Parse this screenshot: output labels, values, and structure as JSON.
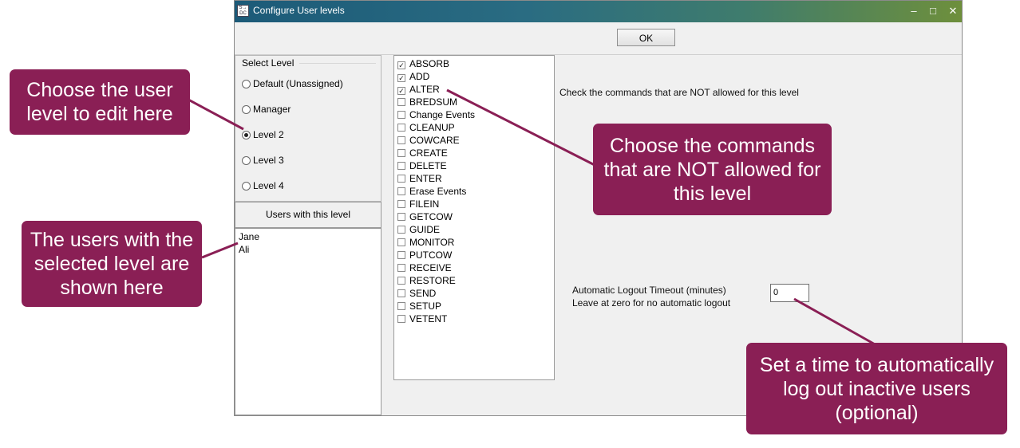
{
  "window": {
    "title": "Configure User levels",
    "icon_label": "S→\nDC",
    "controls": {
      "minimize": "–",
      "maximize": "□",
      "close": "✕"
    }
  },
  "toolbar": {
    "ok_label": "OK"
  },
  "select_level": {
    "label": "Select Level",
    "options": [
      {
        "label": "Default (Unassigned)",
        "selected": false
      },
      {
        "label": "Manager",
        "selected": false
      },
      {
        "label": "Level 2",
        "selected": true
      },
      {
        "label": "Level 3",
        "selected": false
      },
      {
        "label": "Level 4",
        "selected": false
      }
    ]
  },
  "users": {
    "header": "Users with this level",
    "list": [
      "Jane",
      "Ali"
    ]
  },
  "commands": [
    {
      "label": "ABSORB",
      "checked": true
    },
    {
      "label": "ADD",
      "checked": true
    },
    {
      "label": "ALTER",
      "checked": true
    },
    {
      "label": "BREDSUM",
      "checked": false
    },
    {
      "label": "Change Events",
      "checked": false
    },
    {
      "label": "CLEANUP",
      "checked": false
    },
    {
      "label": "COWCARE",
      "checked": false
    },
    {
      "label": "CREATE",
      "checked": false
    },
    {
      "label": "DELETE",
      "checked": false
    },
    {
      "label": "ENTER",
      "checked": false
    },
    {
      "label": "Erase Events",
      "checked": false
    },
    {
      "label": "FILEIN",
      "checked": false
    },
    {
      "label": "GETCOW",
      "checked": false
    },
    {
      "label": "GUIDE",
      "checked": false
    },
    {
      "label": "MONITOR",
      "checked": false
    },
    {
      "label": "PUTCOW",
      "checked": false
    },
    {
      "label": "RECEIVE",
      "checked": false
    },
    {
      "label": "RESTORE",
      "checked": false
    },
    {
      "label": "SEND",
      "checked": false
    },
    {
      "label": "SETUP",
      "checked": false
    },
    {
      "label": "VETENT",
      "checked": false
    }
  ],
  "instructions": "Check the commands that are NOT allowed for this level",
  "timeout": {
    "label_line1": "Automatic Logout Timeout (minutes)",
    "label_line2": "Leave at zero for no automatic logout",
    "value": "0"
  },
  "callouts": {
    "level": "Choose the user level to edit here",
    "users": "The users with the selected level are shown here",
    "commands": "Choose the commands that are NOT allowed for this level",
    "timeout": "Set a time to automatically log out inactive users (optional)"
  },
  "colors": {
    "callout_bg": "#8a1f55",
    "titlebar_start": "#1c5a78",
    "titlebar_end": "#6e8f3c"
  }
}
